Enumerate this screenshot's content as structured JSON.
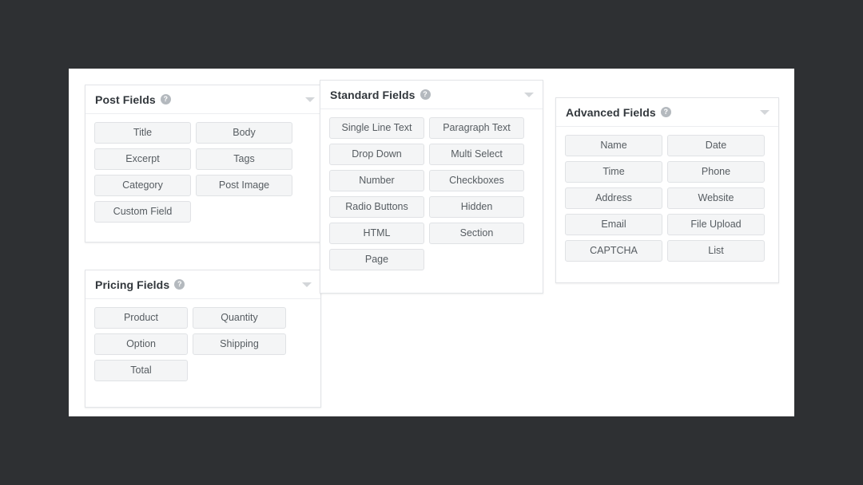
{
  "background_color": "#2e3033",
  "canvas_color": "#ffffff",
  "icons": {
    "help": "help-circle-icon",
    "help_glyph": "?",
    "toggle": "chevron-down-icon"
  },
  "panels": [
    {
      "id": "post",
      "title": "Post Fields",
      "help_tooltip_icon": "?",
      "buttons": [
        "Title",
        "Body",
        "Excerpt",
        "Tags",
        "Category",
        "Post Image",
        "Custom Field"
      ]
    },
    {
      "id": "pricing",
      "title": "Pricing Fields",
      "help_tooltip_icon": "?",
      "buttons": [
        "Product",
        "Quantity",
        "Option",
        "Shipping",
        "Total"
      ]
    },
    {
      "id": "standard",
      "title": "Standard Fields",
      "help_tooltip_icon": "?",
      "buttons": [
        "Single Line Text",
        "Paragraph Text",
        "Drop Down",
        "Multi Select",
        "Number",
        "Checkboxes",
        "Radio Buttons",
        "Hidden",
        "HTML",
        "Section",
        "Page"
      ]
    },
    {
      "id": "advanced",
      "title": "Advanced Fields",
      "help_tooltip_icon": "?",
      "buttons": [
        "Name",
        "Date",
        "Time",
        "Phone",
        "Address",
        "Website",
        "Email",
        "File Upload",
        "CAPTCHA",
        "List"
      ]
    }
  ]
}
